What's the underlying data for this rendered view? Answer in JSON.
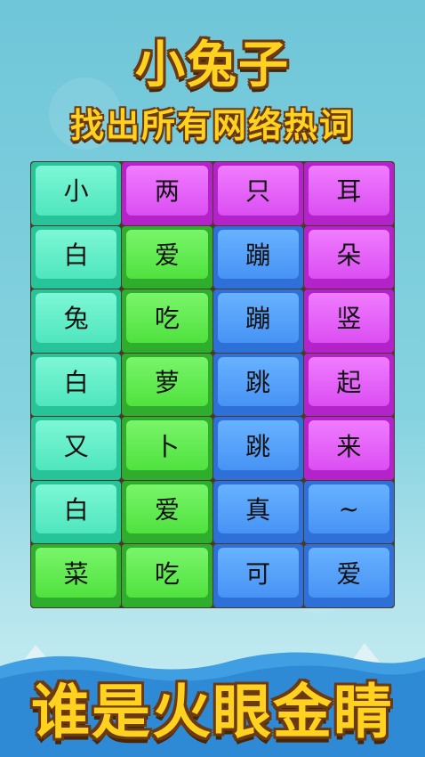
{
  "header": {
    "title": "小兔子",
    "subtitle": "找出所有网络热词"
  },
  "footer": {
    "slogan": "谁是火眼金睛"
  },
  "colors": {
    "teal": "#4fe6bd",
    "purple": "#db4ef2",
    "green": "#50e23f",
    "blue": "#4793f5",
    "title_yellow": "#ffd21f"
  },
  "board": {
    "rows": [
      [
        {
          "char": "小",
          "color": "teal"
        },
        {
          "char": "两",
          "color": "purple"
        },
        {
          "char": "只",
          "color": "purple"
        },
        {
          "char": "耳",
          "color": "purple"
        }
      ],
      [
        {
          "char": "白",
          "color": "teal"
        },
        {
          "char": "爱",
          "color": "green"
        },
        {
          "char": "蹦",
          "color": "blue"
        },
        {
          "char": "朵",
          "color": "purple"
        }
      ],
      [
        {
          "char": "兔",
          "color": "teal"
        },
        {
          "char": "吃",
          "color": "green"
        },
        {
          "char": "蹦",
          "color": "blue"
        },
        {
          "char": "竖",
          "color": "purple"
        }
      ],
      [
        {
          "char": "白",
          "color": "teal"
        },
        {
          "char": "萝",
          "color": "green"
        },
        {
          "char": "跳",
          "color": "blue"
        },
        {
          "char": "起",
          "color": "purple"
        }
      ],
      [
        {
          "char": "又",
          "color": "teal"
        },
        {
          "char": "卜",
          "color": "green"
        },
        {
          "char": "跳",
          "color": "blue"
        },
        {
          "char": "来",
          "color": "purple"
        }
      ],
      [
        {
          "char": "白",
          "color": "teal"
        },
        {
          "char": "爱",
          "color": "green"
        },
        {
          "char": "真",
          "color": "blue"
        },
        {
          "char": "~",
          "color": "blue"
        }
      ],
      [
        {
          "char": "菜",
          "color": "green"
        },
        {
          "char": "吃",
          "color": "green"
        },
        {
          "char": "可",
          "color": "blue"
        },
        {
          "char": "爱",
          "color": "blue"
        }
      ]
    ]
  }
}
